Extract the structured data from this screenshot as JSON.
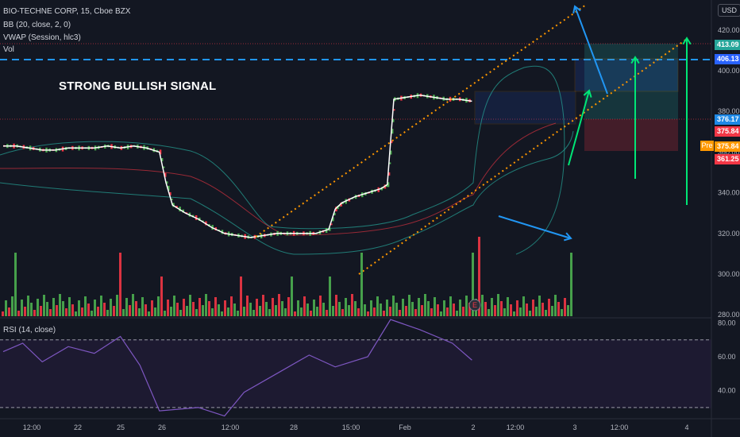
{
  "header": {
    "symbol_line": "BIO-TECHNE CORP, 15, Cboe BZX",
    "bb_line": "BB (20, close, 2, 0)",
    "vwap_line": "VWAP (Session, hlc3)",
    "vol_line": "Vol"
  },
  "currency_button": "USD",
  "annotation": "STRONG BULLISH SIGNAL",
  "rsi_pane_label": "RSI (14, close)",
  "price_badges": [
    {
      "label": "413.09",
      "color": "#26a69a"
    },
    {
      "label": "406.13",
      "color": "#2962ff"
    },
    {
      "label": "376.17",
      "color": "#1e88e5"
    },
    {
      "label": "375.84",
      "color": "#f23645"
    },
    {
      "label": "375.84",
      "color": "#ff9800"
    },
    {
      "label": "361.25",
      "color": "#f23645"
    }
  ],
  "pre_label": "Pre",
  "colors": {
    "up": "#4caf50",
    "down": "#f23645",
    "bb": "#26a69a",
    "vwap": "#ffffff",
    "rsi": "#7e57c2",
    "arrow_blue": "#2196f3",
    "arrow_green": "#00e676",
    "channel": "#ff9800"
  },
  "chart_data": {
    "type": "line",
    "title": "BIO-TECHNE CORP, 15, Cboe BZX",
    "price_axis": {
      "ticks": [
        280.0,
        300.0,
        320.0,
        340.0,
        360.0,
        380.0,
        400.0,
        420.0
      ]
    },
    "rsi_axis": {
      "ticks": [
        40.0,
        60.0,
        80.0
      ],
      "levels": [
        70,
        30
      ]
    },
    "x_ticks": [
      "12:00",
      "22",
      "25",
      "26",
      "12:00",
      "28",
      "15:00",
      "Feb",
      "2",
      "12:00",
      "3",
      "12:00",
      "4"
    ],
    "series": [
      {
        "name": "",
        "x": [
          0,
          20,
          40,
          60,
          80,
          100,
          120,
          140,
          160,
          180,
          200,
          220,
          240,
          250,
          260,
          280,
          300,
          320,
          340,
          360,
          380,
          400,
          420,
          440,
          460,
          480,
          500,
          510,
          520,
          540,
          560,
          580,
          590,
          595,
          600,
          620,
          640,
          660,
          680,
          700,
          720
        ],
        "values": [
          363,
          363,
          362,
          361,
          361,
          362,
          362,
          362,
          363,
          362,
          363,
          362,
          360,
          345,
          334,
          330,
          327,
          323,
          320,
          319,
          318,
          319,
          320,
          320,
          320,
          320,
          322,
          332,
          335,
          338,
          340,
          342,
          344,
          365,
          386,
          387,
          388,
          387,
          386,
          386,
          385
        ]
      }
    ],
    "rsi": {
      "x": [
        0,
        30,
        60,
        100,
        140,
        180,
        210,
        240,
        300,
        340,
        370,
        420,
        470,
        510,
        560,
        595,
        640,
        690,
        720
      ],
      "values": [
        63,
        68,
        57,
        66,
        62,
        72,
        55,
        28,
        30,
        25,
        39,
        50,
        61,
        54,
        60,
        82,
        76,
        68,
        58
      ]
    },
    "levels": [
      {
        "name": "",
        "value": 413.09
      },
      {
        "name": "",
        "value": 406.13
      },
      {
        "name": "",
        "value": 376.17
      },
      {
        "name": "",
        "value": 375.84
      },
      {
        "name": "",
        "value": 361.25
      }
    ]
  }
}
